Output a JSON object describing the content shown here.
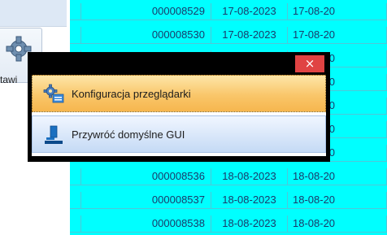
{
  "left_panel": {
    "button_label": "tawi"
  },
  "grid": {
    "rows": [
      {
        "number": "000008529",
        "date": "17-08-2023",
        "date2": "17-08-20"
      },
      {
        "number": "000008530",
        "date": "17-08-2023",
        "date2": "17-08-20"
      },
      {
        "number": "",
        "date": "",
        "date2": "17-08-20"
      },
      {
        "number": "",
        "date": "",
        "date2": "18-08-20"
      },
      {
        "number": "",
        "date": "",
        "date2": "18-08-20"
      },
      {
        "number": "",
        "date": "",
        "date2": "18-08-20"
      },
      {
        "number": "",
        "date": "",
        "date2": "18-08-20"
      },
      {
        "number": "000008536",
        "date": "18-08-2023",
        "date2": "18-08-20"
      },
      {
        "number": "000008537",
        "date": "18-08-2023",
        "date2": "18-08-20"
      },
      {
        "number": "000008538",
        "date": "18-08-2023",
        "date2": "18-08-20"
      }
    ]
  },
  "popup": {
    "close_glyph": "×",
    "items": [
      {
        "label": "Konfiguracja przeglądarki",
        "icon": "gear-settings-icon"
      },
      {
        "label": "Przywróć domyślne GUI",
        "icon": "restore-gui-icon"
      }
    ]
  },
  "colors": {
    "grid_bg": "#00ffff",
    "highlight": "#f9c66a",
    "close": "#e04343"
  }
}
